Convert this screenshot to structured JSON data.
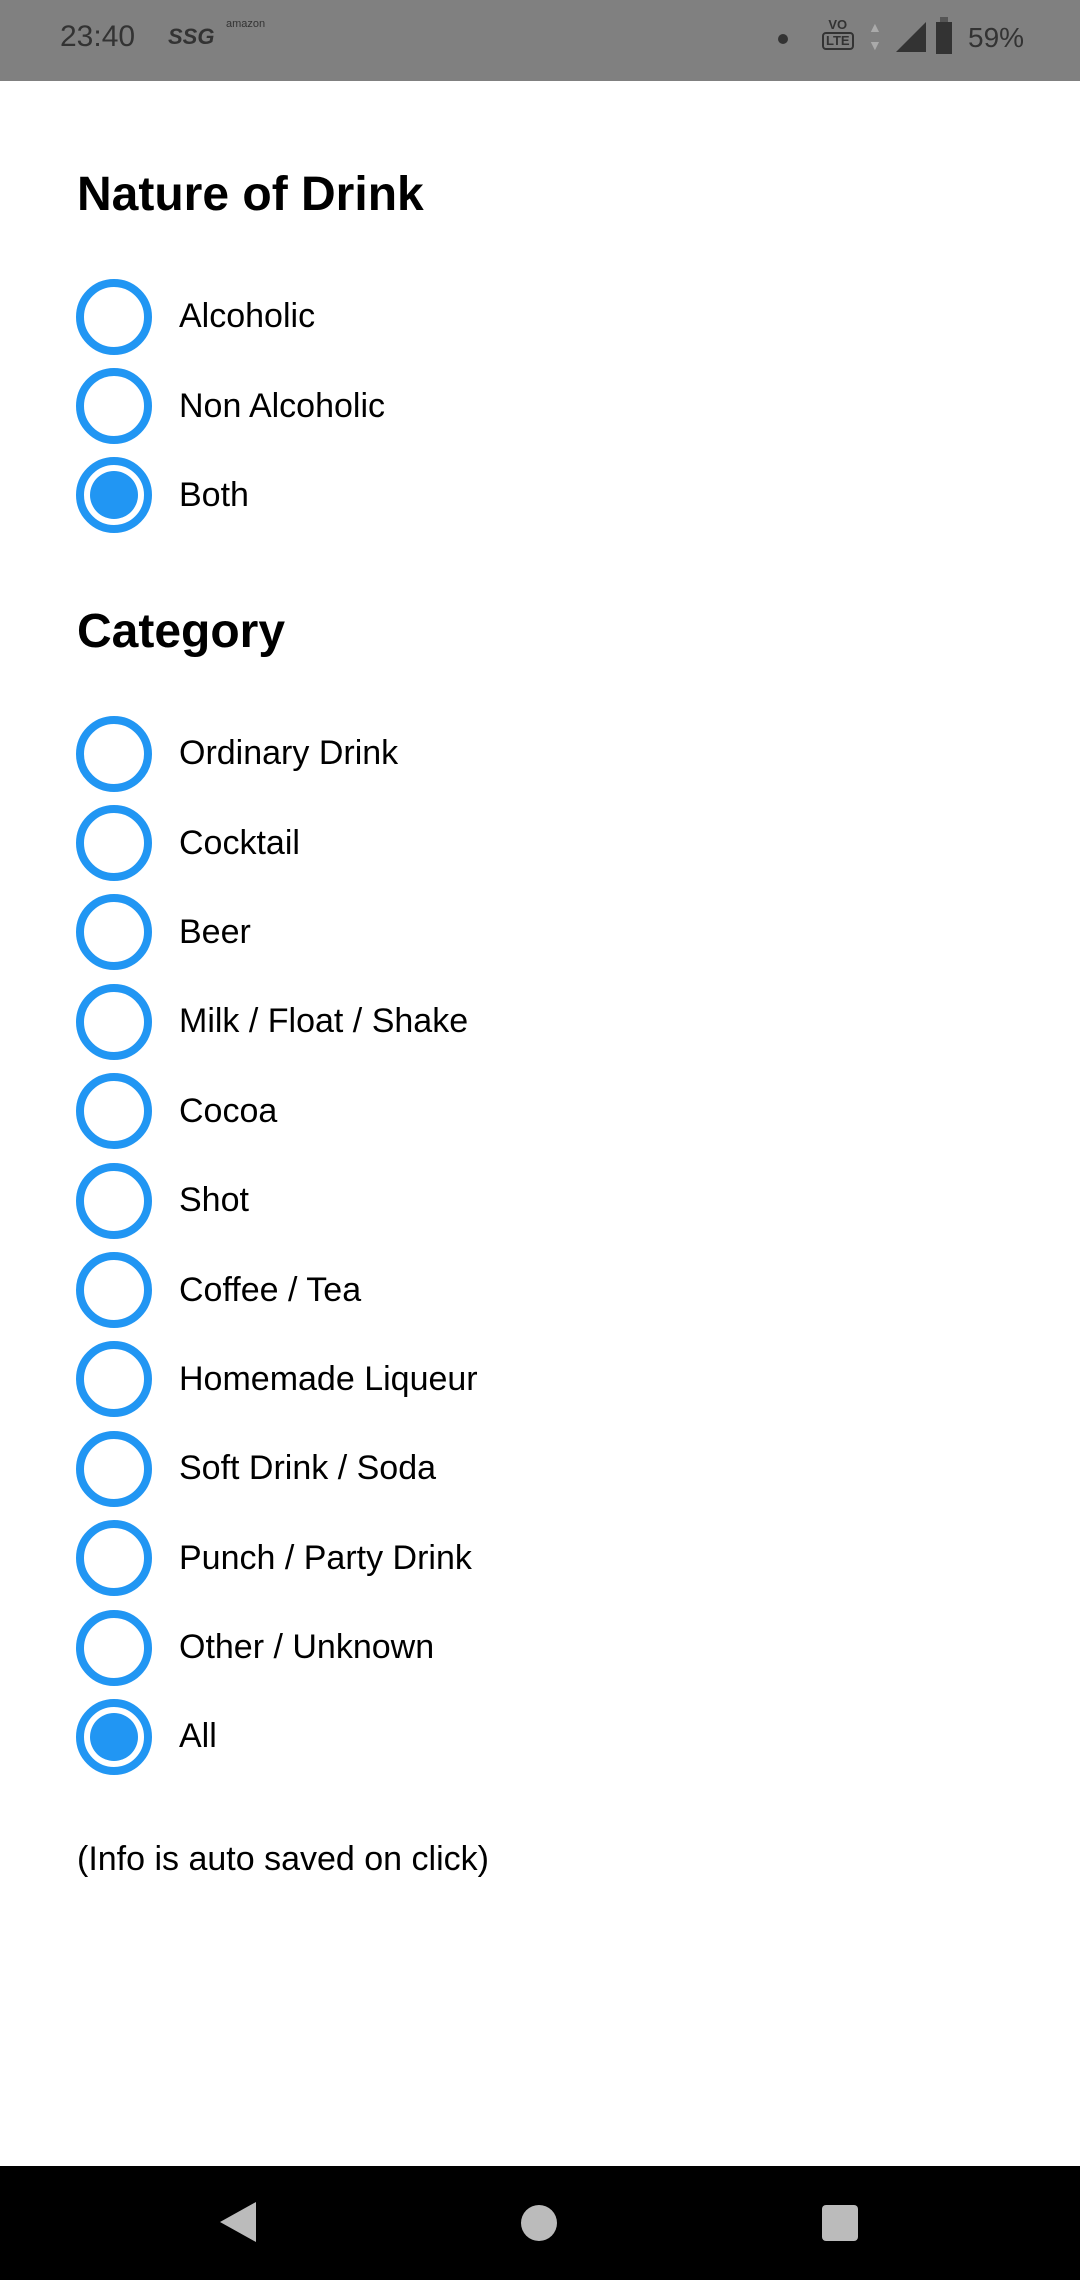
{
  "status_bar": {
    "time": "23:40",
    "ssg": "SSG",
    "amazon": "amazon",
    "volte": "VoLTE",
    "volte_top": "VO",
    "volte_bottom": "LTE",
    "battery": "59%"
  },
  "nature": {
    "title": "Nature of Drink",
    "options": [
      {
        "label": "Alcoholic",
        "checked": false
      },
      {
        "label": "Non Alcoholic",
        "checked": false
      },
      {
        "label": "Both",
        "checked": true
      }
    ]
  },
  "category": {
    "title": "Category",
    "options": [
      {
        "label": "Ordinary Drink",
        "checked": false
      },
      {
        "label": "Cocktail",
        "checked": false
      },
      {
        "label": "Beer",
        "checked": false
      },
      {
        "label": "Milk / Float / Shake",
        "checked": false
      },
      {
        "label": "Cocoa",
        "checked": false
      },
      {
        "label": "Shot",
        "checked": false
      },
      {
        "label": "Coffee / Tea",
        "checked": false
      },
      {
        "label": "Homemade Liqueur",
        "checked": false
      },
      {
        "label": "Soft Drink / Soda",
        "checked": false
      },
      {
        "label": "Punch / Party Drink",
        "checked": false
      },
      {
        "label": "Other / Unknown",
        "checked": false
      },
      {
        "label": "All",
        "checked": true
      }
    ]
  },
  "info": "(Info is auto saved on click)",
  "accent_color": "#2196F3"
}
